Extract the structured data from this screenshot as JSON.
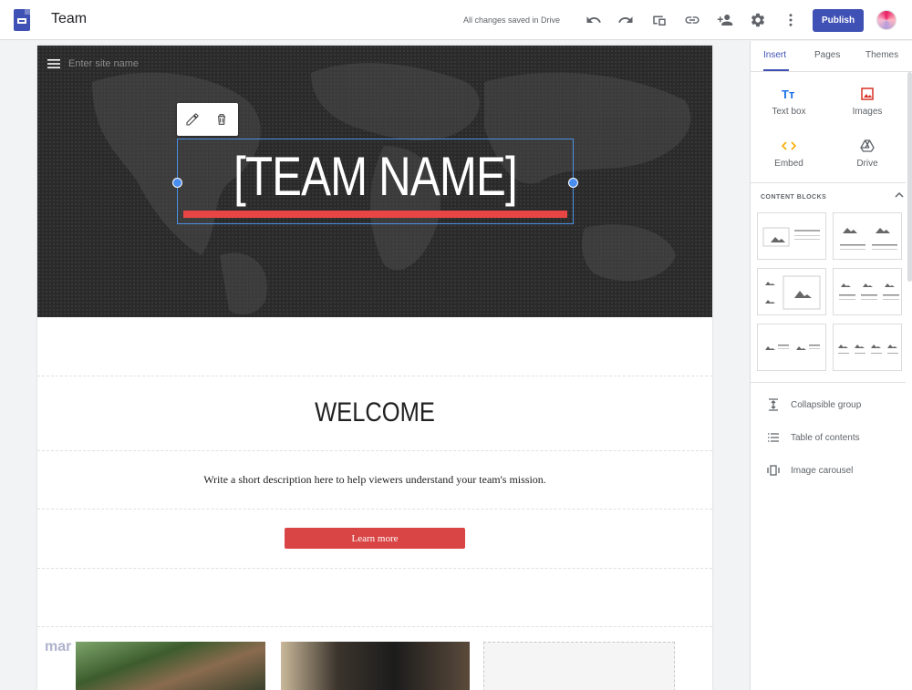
{
  "header": {
    "doc_title": "Team",
    "save_status": "All changes saved in Drive",
    "publish_label": "Publish",
    "icons": [
      "undo-icon",
      "redo-icon",
      "preview-icon",
      "link-icon",
      "add-person-icon",
      "settings-icon",
      "more-icon"
    ]
  },
  "site": {
    "site_name_placeholder": "Enter site name",
    "hero_title": "[TEAM NAME]",
    "welcome_heading": "WELCOME",
    "description": "Write a short description here to help viewers understand your team's mission.",
    "button_label": "Learn more",
    "watermark": "mar"
  },
  "panel": {
    "tabs": [
      {
        "label": "Insert",
        "active": true
      },
      {
        "label": "Pages",
        "active": false
      },
      {
        "label": "Themes",
        "active": false
      }
    ],
    "insert_items": [
      {
        "label": "Text box",
        "icon": "text-box-icon",
        "color": "#1a73e8"
      },
      {
        "label": "Images",
        "icon": "image-icon",
        "color": "#d93025"
      },
      {
        "label": "Embed",
        "icon": "embed-icon",
        "color": "#f9ab00"
      },
      {
        "label": "Drive",
        "icon": "drive-icon",
        "color": "#5f6368"
      }
    ],
    "content_blocks_title": "CONTENT BLOCKS",
    "list_items": [
      {
        "label": "Collapsible group",
        "icon": "collapsible-icon"
      },
      {
        "label": "Table of contents",
        "icon": "list-icon"
      },
      {
        "label": "Image carousel",
        "icon": "carousel-icon"
      }
    ]
  },
  "colors": {
    "accent": "#3f51b5",
    "hero_bg": "#2a2a2a",
    "title_underline": "#e84545",
    "button": "#d94545",
    "selection": "#4a90e2"
  }
}
